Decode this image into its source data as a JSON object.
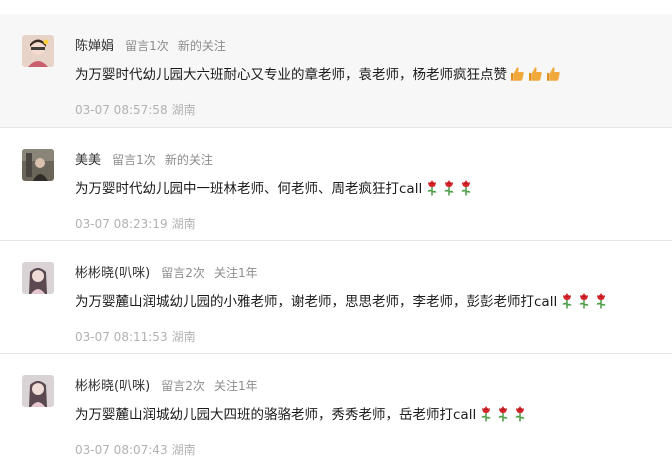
{
  "comments": [
    {
      "nickname": "陈婵娟",
      "stat": "留言1次",
      "follow": "新的关注",
      "text": "为万婴时代幼儿园大六班耐心又专业的章老师，袁老师，杨老师疯狂点赞",
      "emoji": "thumbs-up-icon",
      "emoji_count": 3,
      "time": "03-07 08:57:58",
      "location": "湖南",
      "highlight": true
    },
    {
      "nickname": "美美",
      "stat": "留言1次",
      "follow": "新的关注",
      "text": "为万婴时代幼儿园中一班林老师、何老师、周老疯狂打call",
      "emoji": "rose-icon",
      "emoji_count": 3,
      "time": "03-07 08:23:19",
      "location": "湖南",
      "highlight": false
    },
    {
      "nickname": "彬彬晓(叭咪)",
      "stat": "留言2次",
      "follow": "关注1年",
      "text": "为万婴麓山润城幼儿园的小雅老师，谢老师，思思老师，李老师，彭彭老师打call",
      "emoji": "rose-icon",
      "emoji_count": 3,
      "time": "03-07 08:11:53",
      "location": "湖南",
      "highlight": false
    },
    {
      "nickname": "彬彬晓(叭咪)",
      "stat": "留言2次",
      "follow": "关注1年",
      "text": "为万婴麓山润城幼儿园大四班的骆骆老师，秀秀老师，岳老师打call",
      "emoji": "rose-icon",
      "emoji_count": 3,
      "time": "03-07 08:07:43",
      "location": "湖南",
      "highlight": false
    }
  ],
  "colors": {
    "highlight_bg": "#f7f7f7",
    "secondary_text": "#8c8c8c",
    "time_text": "#b2b2b2",
    "thumb": "#f2a93b",
    "rose": "#d6242a"
  }
}
